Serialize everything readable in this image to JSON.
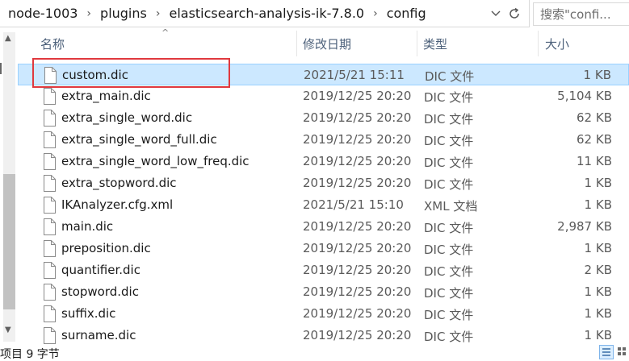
{
  "address": {
    "crumbs": [
      "node-1003",
      "plugins",
      "elasticsearch-analysis-ik-7.8.0",
      "config"
    ],
    "separator": "›"
  },
  "search": {
    "placeholder": "搜索\"confi..."
  },
  "columns": {
    "name": "名称",
    "date": "修改日期",
    "type": "类型",
    "size": "大小"
  },
  "files": [
    {
      "name": "custom.dic",
      "date": "2021/5/21 15:11",
      "type": "DIC 文件",
      "size": "1 KB",
      "selected": true
    },
    {
      "name": "extra_main.dic",
      "date": "2019/12/25 20:20",
      "type": "DIC 文件",
      "size": "5,104 KB"
    },
    {
      "name": "extra_single_word.dic",
      "date": "2019/12/25 20:20",
      "type": "DIC 文件",
      "size": "62 KB"
    },
    {
      "name": "extra_single_word_full.dic",
      "date": "2019/12/25 20:20",
      "type": "DIC 文件",
      "size": "62 KB"
    },
    {
      "name": "extra_single_word_low_freq.dic",
      "date": "2019/12/25 20:20",
      "type": "DIC 文件",
      "size": "11 KB"
    },
    {
      "name": "extra_stopword.dic",
      "date": "2019/12/25 20:20",
      "type": "DIC 文件",
      "size": "1 KB"
    },
    {
      "name": "IKAnalyzer.cfg.xml",
      "date": "2021/5/21 15:10",
      "type": "XML 文档",
      "size": "1 KB"
    },
    {
      "name": "main.dic",
      "date": "2019/12/25 20:20",
      "type": "DIC 文件",
      "size": "2,987 KB"
    },
    {
      "name": "preposition.dic",
      "date": "2019/12/25 20:20",
      "type": "DIC 文件",
      "size": "1 KB"
    },
    {
      "name": "quantifier.dic",
      "date": "2019/12/25 20:20",
      "type": "DIC 文件",
      "size": "2 KB"
    },
    {
      "name": "stopword.dic",
      "date": "2019/12/25 20:20",
      "type": "DIC 文件",
      "size": "1 KB"
    },
    {
      "name": "suffix.dic",
      "date": "2019/12/25 20:20",
      "type": "DIC 文件",
      "size": "1 KB"
    },
    {
      "name": "surname.dic",
      "date": "2019/12/25 20:20",
      "type": "DIC 文件",
      "size": "1 KB"
    }
  ],
  "status": {
    "count_text": "项目 9 字节"
  },
  "colors": {
    "selection_bg": "#cce8ff",
    "selection_border": "#99d1ff",
    "highlight_box": "#e0393e",
    "header_text": "#4c607a"
  },
  "icons": {
    "file": "file-icon",
    "dropdown": "chevron-down-icon",
    "refresh": "refresh-icon",
    "details_view": "details-view-icon",
    "tiles_view": "tiles-view-icon"
  }
}
